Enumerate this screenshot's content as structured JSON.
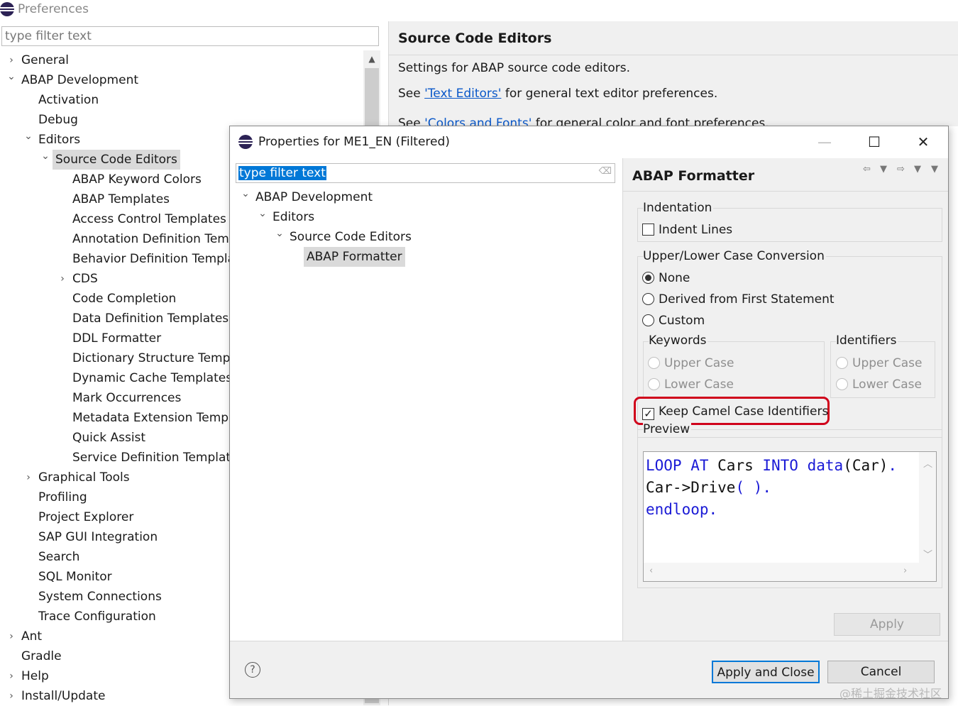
{
  "background_window": {
    "title": "Preferences",
    "filter_placeholder": "type filter text",
    "tree": [
      {
        "label": "General",
        "chevron": "›"
      },
      {
        "label": "ABAP Development",
        "chevron": "⌄"
      },
      {
        "label": "Activation",
        "chevron": ""
      },
      {
        "label": "Debug",
        "chevron": ""
      },
      {
        "label": "Editors",
        "chevron": "⌄"
      },
      {
        "label": "Source Code Editors",
        "chevron": "⌄"
      },
      {
        "label": "ABAP Keyword Colors",
        "chevron": ""
      },
      {
        "label": "ABAP Templates",
        "chevron": ""
      },
      {
        "label": "Access Control Templates",
        "chevron": ""
      },
      {
        "label": "Annotation Definition Templ",
        "chevron": ""
      },
      {
        "label": "Behavior Definition Template",
        "chevron": ""
      },
      {
        "label": "CDS",
        "chevron": "›"
      },
      {
        "label": "Code Completion",
        "chevron": ""
      },
      {
        "label": "Data Definition Templates",
        "chevron": ""
      },
      {
        "label": "DDL Formatter",
        "chevron": ""
      },
      {
        "label": "Dictionary Structure Templat",
        "chevron": ""
      },
      {
        "label": "Dynamic Cache Templates",
        "chevron": ""
      },
      {
        "label": "Mark Occurrences",
        "chevron": ""
      },
      {
        "label": "Metadata Extension Templat",
        "chevron": ""
      },
      {
        "label": "Quick Assist",
        "chevron": ""
      },
      {
        "label": "Service Definition Templates",
        "chevron": ""
      },
      {
        "label": "Graphical Tools",
        "chevron": "›"
      },
      {
        "label": "Profiling",
        "chevron": ""
      },
      {
        "label": "Project Explorer",
        "chevron": ""
      },
      {
        "label": "SAP GUI Integration",
        "chevron": ""
      },
      {
        "label": "Search",
        "chevron": ""
      },
      {
        "label": "SQL Monitor",
        "chevron": ""
      },
      {
        "label": "System Connections",
        "chevron": ""
      },
      {
        "label": "Trace Configuration",
        "chevron": ""
      },
      {
        "label": "Ant",
        "chevron": "›"
      },
      {
        "label": "Gradle",
        "chevron": ""
      },
      {
        "label": "Help",
        "chevron": "›"
      },
      {
        "label": "Install/Update",
        "chevron": "›"
      }
    ],
    "page_title": "Source Code Editors",
    "description": "Settings for ABAP source code editors.",
    "see1_prefix": "See ",
    "see1_link": "'Text Editors'",
    "see1_suffix": " for general text editor preferences.",
    "see2_prefix": "See ",
    "see2_link": "'Colors and Fonts'",
    "see2_suffix": " for general color and font preferences."
  },
  "dialog": {
    "title": "Properties for ME1_EN (Filtered)",
    "filter_text": "type filter text",
    "tree": [
      {
        "label": "ABAP Development",
        "chevron": "⌄"
      },
      {
        "label": "Editors",
        "chevron": "⌄"
      },
      {
        "label": "Source Code Editors",
        "chevron": "⌄"
      },
      {
        "label": "ABAP Formatter",
        "chevron": ""
      }
    ],
    "page_title": "ABAP Formatter",
    "indentation": {
      "label": "Indentation",
      "indent_lines": "Indent Lines",
      "indent_lines_checked": false
    },
    "case_conversion": {
      "label": "Upper/Lower Case Conversion",
      "options": [
        "None",
        "Derived from First Statement",
        "Custom"
      ],
      "selected": "None",
      "keywords_label": "Keywords",
      "keywords_options": [
        "Upper Case",
        "Lower Case"
      ],
      "identifiers_label": "Identifiers",
      "identifiers_options": [
        "Upper Case",
        "Lower Case"
      ]
    },
    "keep_camel_case": {
      "label": "Keep Camel Case Identifiers",
      "checked": true
    },
    "preview": {
      "label": "Preview",
      "line1": [
        {
          "t": "LOOP AT",
          "k": true
        },
        {
          "t": " Cars ",
          "k": false
        },
        {
          "t": "INTO",
          "k": true
        },
        {
          "t": " ",
          "k": false
        },
        {
          "t": "data",
          "k": true
        },
        {
          "t": "(Car)",
          "k": false
        },
        {
          "t": ".",
          "k": true
        }
      ],
      "line2": [
        {
          "t": "Car->Drive",
          "k": false
        },
        {
          "t": "( ).",
          "k": true
        }
      ],
      "line3": [
        {
          "t": "endloop.",
          "k": true
        }
      ]
    },
    "apply_label": "Apply",
    "apply_and_close_label": "Apply and Close",
    "cancel_label": "Cancel",
    "help_glyph": "?"
  },
  "watermark": "@稀土掘金技术社区",
  "colors": {
    "keyword": "#1a1ad6",
    "highlight_box": "#d0021b",
    "selection": "#0078d7"
  }
}
